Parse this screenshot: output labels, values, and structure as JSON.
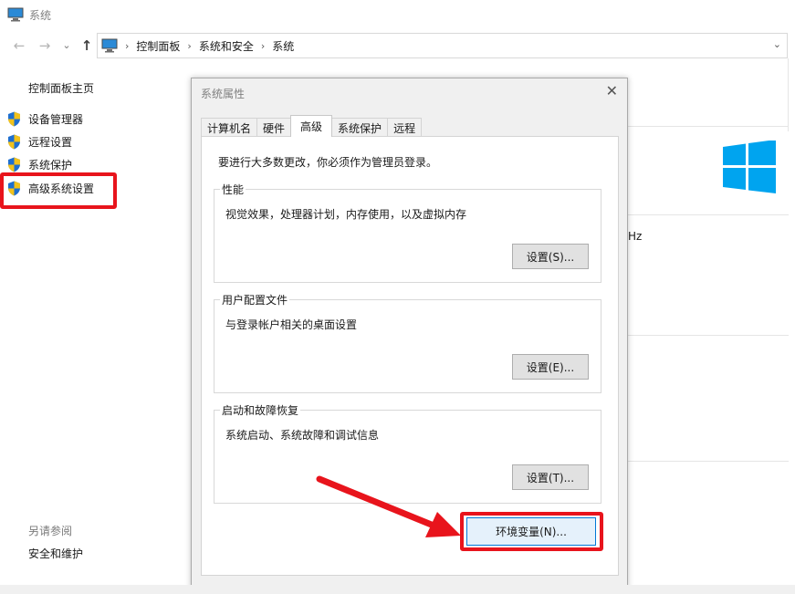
{
  "window": {
    "title": "系统"
  },
  "breadcrumb": {
    "items": [
      "控制面板",
      "系统和安全",
      "系统"
    ]
  },
  "left_panel": {
    "home": "控制面板主页",
    "links": [
      "设备管理器",
      "远程设置",
      "系统保护",
      "高级系统设置"
    ],
    "see_also_heading": "另请参阅",
    "see_also_links": [
      "安全和维护"
    ]
  },
  "background": {
    "partial_text": "Hz"
  },
  "dialog": {
    "title": "系统属性",
    "tabs": [
      "计算机名",
      "硬件",
      "高级",
      "系统保护",
      "远程"
    ],
    "active_tab": "高级",
    "admin_message": "要进行大多数更改，你必须作为管理员登录。",
    "groups": [
      {
        "legend": "性能",
        "description": "视觉效果，处理器计划，内存使用，以及虚拟内存",
        "button": "设置(S)..."
      },
      {
        "legend": "用户配置文件",
        "description": "与登录帐户相关的桌面设置",
        "button": "设置(E)..."
      },
      {
        "legend": "启动和故障恢复",
        "description": "系统启动、系统故障和调试信息",
        "button": "设置(T)..."
      }
    ],
    "env_button": "环境变量(N)..."
  },
  "colors": {
    "highlight": "#e8141c",
    "shield_blue": "#1e6fd0",
    "shield_yellow": "#f2c21b",
    "windows_logo": "#00a4ef"
  },
  "icons": [
    "computer-icon",
    "back-arrow-icon",
    "forward-arrow-icon",
    "up-arrow-icon",
    "shield-icon",
    "close-icon",
    "windows-logo-icon",
    "chevron-down-icon",
    "red-arrow-icon"
  ]
}
